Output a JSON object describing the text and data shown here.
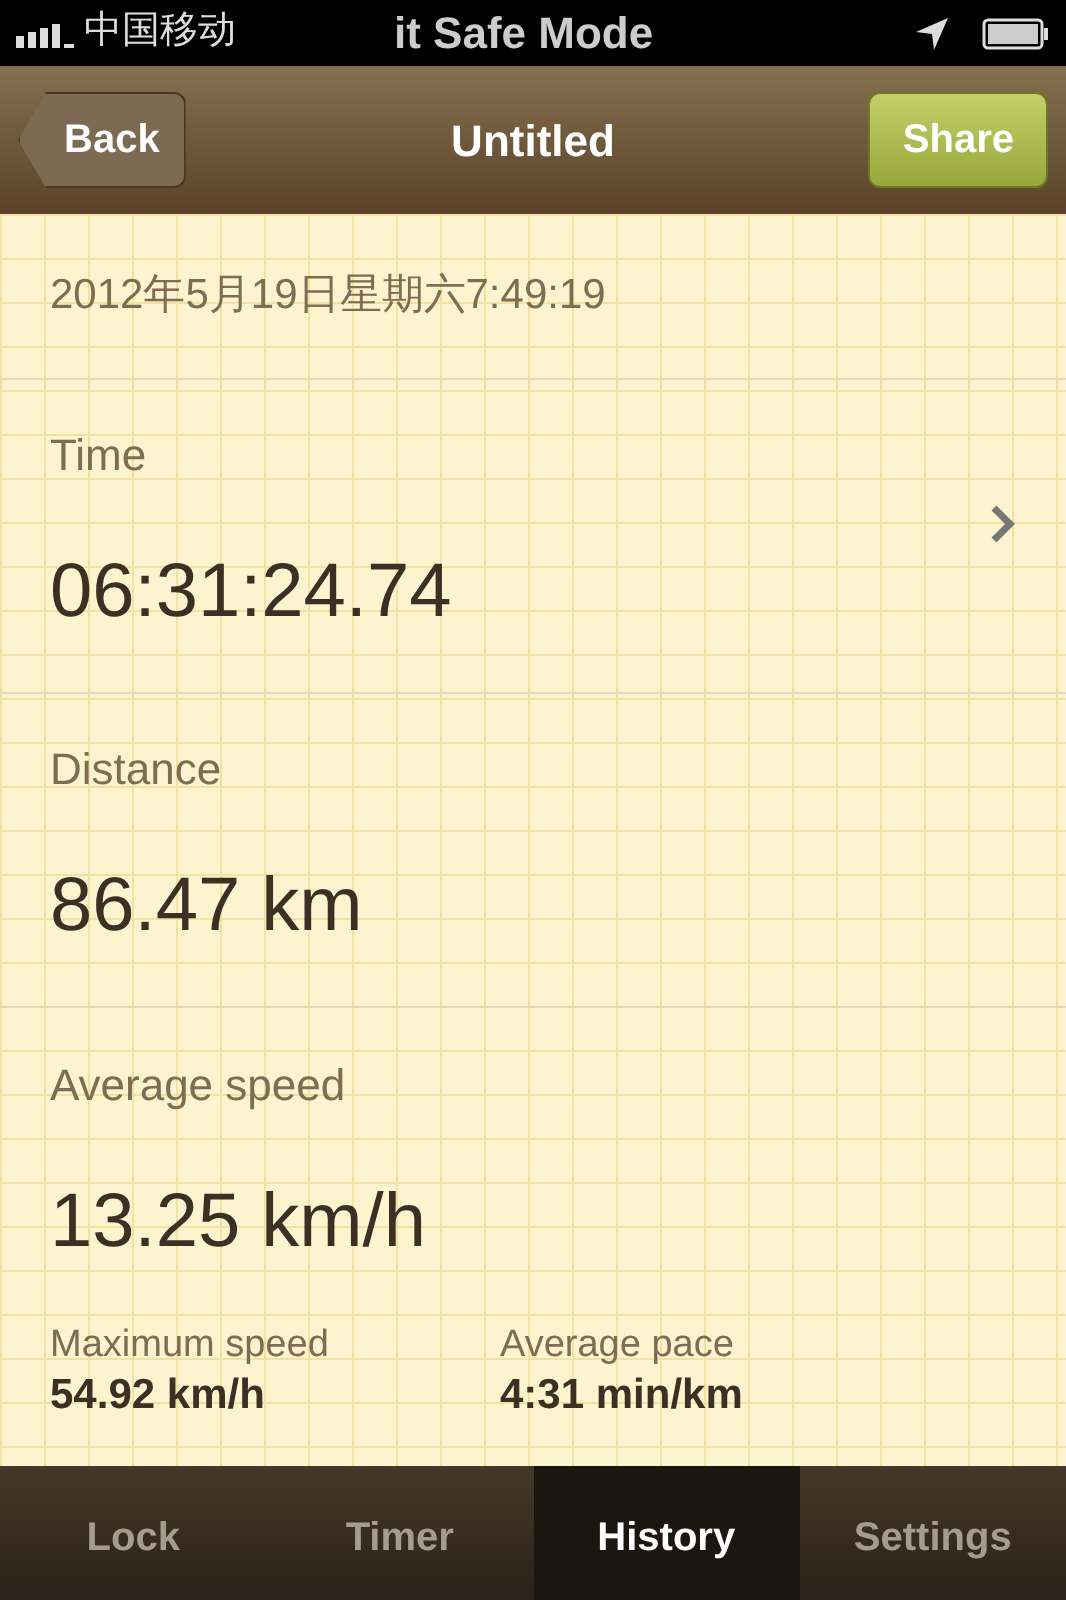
{
  "status_bar": {
    "carrier": "中国移动",
    "title": "it Safe Mode"
  },
  "nav": {
    "back": "Back",
    "title": "Untitled",
    "action": "Share"
  },
  "date": "2012年5月19日星期六7:49:19",
  "metrics": [
    {
      "label": "Time",
      "value": "06:31:24.74",
      "disclosure": true
    },
    {
      "label": "Distance",
      "value": "86.47 km",
      "disclosure": false
    },
    {
      "label": "Average speed",
      "value": "13.25 km/h",
      "disclosure": false
    }
  ],
  "stats": [
    {
      "label": "Maximum speed",
      "value": "54.92 km/h"
    },
    {
      "label": "Average pace",
      "value": "4:31 min/km"
    }
  ],
  "tabs": [
    {
      "label": "Lock",
      "selected": false
    },
    {
      "label": "Timer",
      "selected": false
    },
    {
      "label": "History",
      "selected": true
    },
    {
      "label": "Settings",
      "selected": false
    }
  ]
}
